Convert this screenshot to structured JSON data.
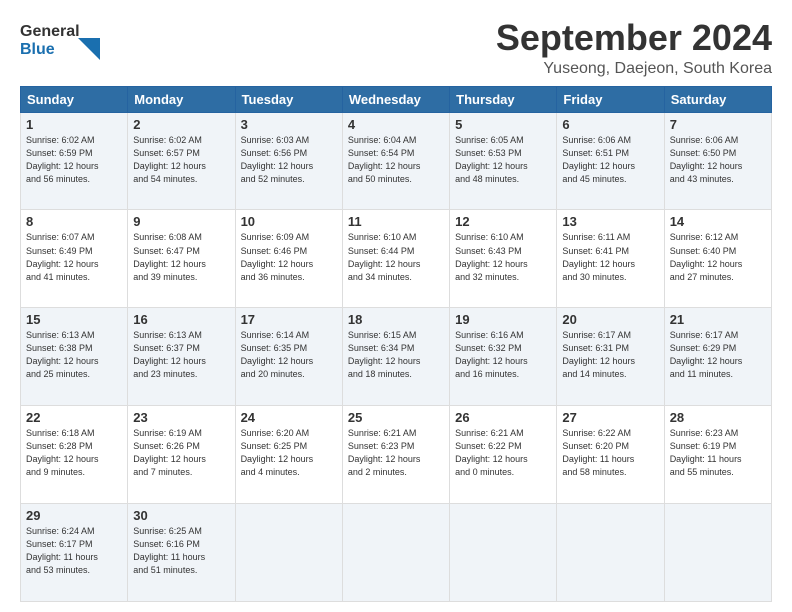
{
  "logo": {
    "line1": "General",
    "line2": "Blue"
  },
  "title": "September 2024",
  "location": "Yuseong, Daejeon, South Korea",
  "days_of_week": [
    "Sunday",
    "Monday",
    "Tuesday",
    "Wednesday",
    "Thursday",
    "Friday",
    "Saturday"
  ],
  "weeks": [
    [
      {
        "day": "1",
        "info": "Sunrise: 6:02 AM\nSunset: 6:59 PM\nDaylight: 12 hours\nand 56 minutes."
      },
      {
        "day": "2",
        "info": "Sunrise: 6:02 AM\nSunset: 6:57 PM\nDaylight: 12 hours\nand 54 minutes."
      },
      {
        "day": "3",
        "info": "Sunrise: 6:03 AM\nSunset: 6:56 PM\nDaylight: 12 hours\nand 52 minutes."
      },
      {
        "day": "4",
        "info": "Sunrise: 6:04 AM\nSunset: 6:54 PM\nDaylight: 12 hours\nand 50 minutes."
      },
      {
        "day": "5",
        "info": "Sunrise: 6:05 AM\nSunset: 6:53 PM\nDaylight: 12 hours\nand 48 minutes."
      },
      {
        "day": "6",
        "info": "Sunrise: 6:06 AM\nSunset: 6:51 PM\nDaylight: 12 hours\nand 45 minutes."
      },
      {
        "day": "7",
        "info": "Sunrise: 6:06 AM\nSunset: 6:50 PM\nDaylight: 12 hours\nand 43 minutes."
      }
    ],
    [
      {
        "day": "8",
        "info": "Sunrise: 6:07 AM\nSunset: 6:49 PM\nDaylight: 12 hours\nand 41 minutes."
      },
      {
        "day": "9",
        "info": "Sunrise: 6:08 AM\nSunset: 6:47 PM\nDaylight: 12 hours\nand 39 minutes."
      },
      {
        "day": "10",
        "info": "Sunrise: 6:09 AM\nSunset: 6:46 PM\nDaylight: 12 hours\nand 36 minutes."
      },
      {
        "day": "11",
        "info": "Sunrise: 6:10 AM\nSunset: 6:44 PM\nDaylight: 12 hours\nand 34 minutes."
      },
      {
        "day": "12",
        "info": "Sunrise: 6:10 AM\nSunset: 6:43 PM\nDaylight: 12 hours\nand 32 minutes."
      },
      {
        "day": "13",
        "info": "Sunrise: 6:11 AM\nSunset: 6:41 PM\nDaylight: 12 hours\nand 30 minutes."
      },
      {
        "day": "14",
        "info": "Sunrise: 6:12 AM\nSunset: 6:40 PM\nDaylight: 12 hours\nand 27 minutes."
      }
    ],
    [
      {
        "day": "15",
        "info": "Sunrise: 6:13 AM\nSunset: 6:38 PM\nDaylight: 12 hours\nand 25 minutes."
      },
      {
        "day": "16",
        "info": "Sunrise: 6:13 AM\nSunset: 6:37 PM\nDaylight: 12 hours\nand 23 minutes."
      },
      {
        "day": "17",
        "info": "Sunrise: 6:14 AM\nSunset: 6:35 PM\nDaylight: 12 hours\nand 20 minutes."
      },
      {
        "day": "18",
        "info": "Sunrise: 6:15 AM\nSunset: 6:34 PM\nDaylight: 12 hours\nand 18 minutes."
      },
      {
        "day": "19",
        "info": "Sunrise: 6:16 AM\nSunset: 6:32 PM\nDaylight: 12 hours\nand 16 minutes."
      },
      {
        "day": "20",
        "info": "Sunrise: 6:17 AM\nSunset: 6:31 PM\nDaylight: 12 hours\nand 14 minutes."
      },
      {
        "day": "21",
        "info": "Sunrise: 6:17 AM\nSunset: 6:29 PM\nDaylight: 12 hours\nand 11 minutes."
      }
    ],
    [
      {
        "day": "22",
        "info": "Sunrise: 6:18 AM\nSunset: 6:28 PM\nDaylight: 12 hours\nand 9 minutes."
      },
      {
        "day": "23",
        "info": "Sunrise: 6:19 AM\nSunset: 6:26 PM\nDaylight: 12 hours\nand 7 minutes."
      },
      {
        "day": "24",
        "info": "Sunrise: 6:20 AM\nSunset: 6:25 PM\nDaylight: 12 hours\nand 4 minutes."
      },
      {
        "day": "25",
        "info": "Sunrise: 6:21 AM\nSunset: 6:23 PM\nDaylight: 12 hours\nand 2 minutes."
      },
      {
        "day": "26",
        "info": "Sunrise: 6:21 AM\nSunset: 6:22 PM\nDaylight: 12 hours\nand 0 minutes."
      },
      {
        "day": "27",
        "info": "Sunrise: 6:22 AM\nSunset: 6:20 PM\nDaylight: 11 hours\nand 58 minutes."
      },
      {
        "day": "28",
        "info": "Sunrise: 6:23 AM\nSunset: 6:19 PM\nDaylight: 11 hours\nand 55 minutes."
      }
    ],
    [
      {
        "day": "29",
        "info": "Sunrise: 6:24 AM\nSunset: 6:17 PM\nDaylight: 11 hours\nand 53 minutes."
      },
      {
        "day": "30",
        "info": "Sunrise: 6:25 AM\nSunset: 6:16 PM\nDaylight: 11 hours\nand 51 minutes."
      },
      {
        "day": "",
        "info": ""
      },
      {
        "day": "",
        "info": ""
      },
      {
        "day": "",
        "info": ""
      },
      {
        "day": "",
        "info": ""
      },
      {
        "day": "",
        "info": ""
      }
    ]
  ]
}
